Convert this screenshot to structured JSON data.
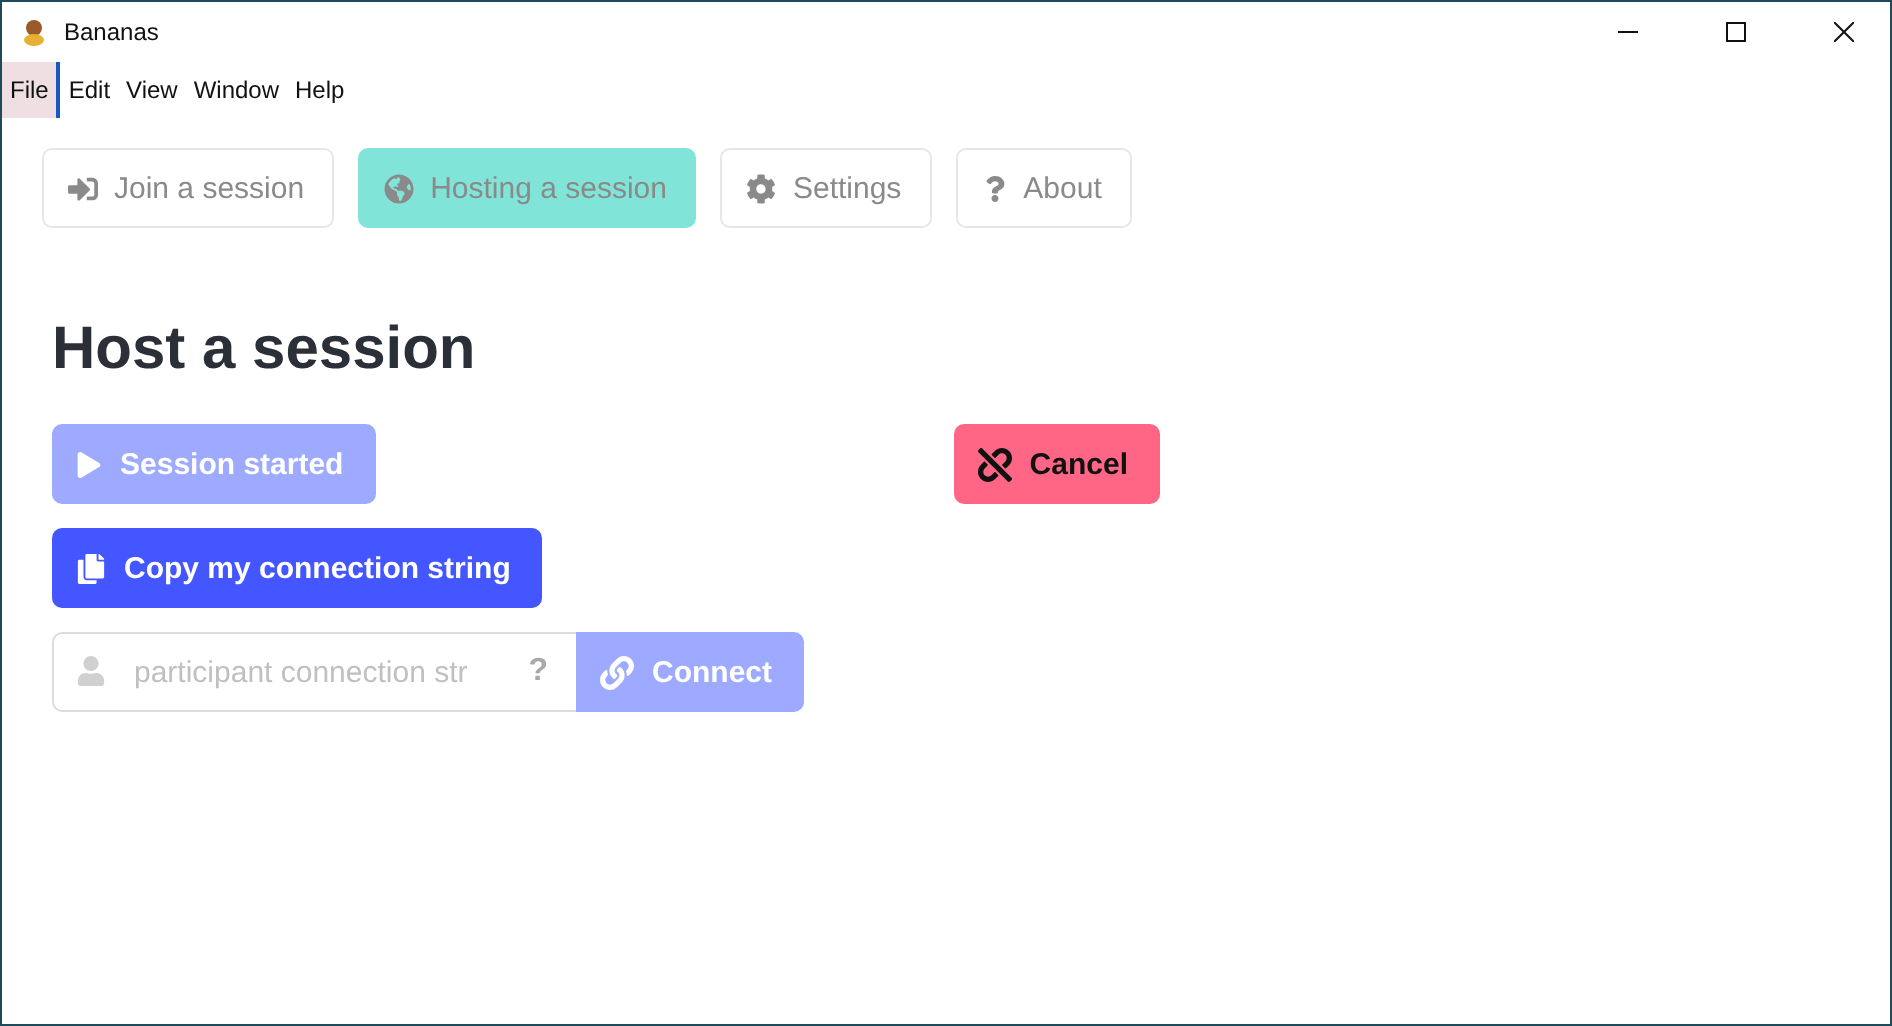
{
  "window": {
    "title": "Bananas"
  },
  "menu": [
    {
      "label": "File",
      "selected": true
    },
    {
      "label": "Edit",
      "selected": false
    },
    {
      "label": "View",
      "selected": false
    },
    {
      "label": "Window",
      "selected": false
    },
    {
      "label": "Help",
      "selected": false
    }
  ],
  "tabs": [
    {
      "label": "Join a session",
      "kind": "join",
      "selected": false
    },
    {
      "label": "Hosting a session",
      "kind": "host",
      "selected": true
    },
    {
      "label": "Settings",
      "kind": "settings",
      "selected": false
    },
    {
      "label": "About",
      "kind": "about",
      "selected": false
    }
  ],
  "heading": "Host a session",
  "session_button": {
    "label": "Session started",
    "disabled": true
  },
  "cancel_button": {
    "label": "Cancel"
  },
  "copy_button": {
    "label": "Copy my connection string",
    "disabled": false
  },
  "connect": {
    "placeholder": "participant connection str",
    "help": "?",
    "button": {
      "label": "Connect",
      "disabled": true
    }
  }
}
